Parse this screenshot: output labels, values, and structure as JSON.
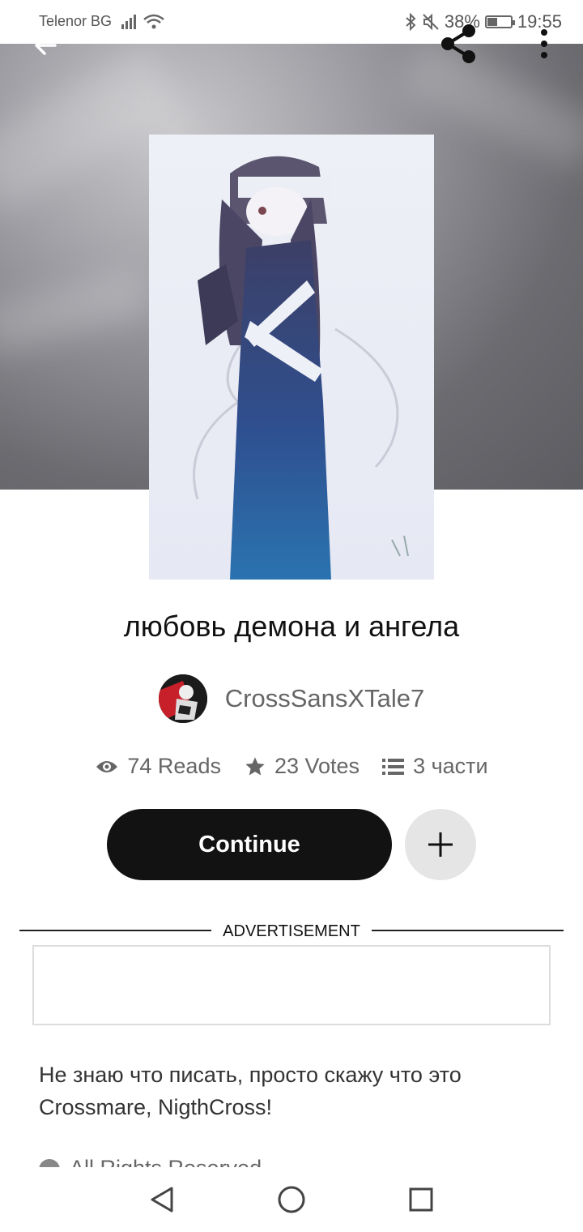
{
  "status_bar": {
    "carrier": "Telenor BG",
    "battery": "38%",
    "time": "19:55"
  },
  "header": {
    "back_icon": "arrow-left-icon",
    "share_icon": "share-icon",
    "more_icon": "more-vertical-icon"
  },
  "story": {
    "title": "любовь демона и ангела",
    "author": "CrossSansXTale7",
    "reads": "74 Reads",
    "votes": "23 Votes",
    "parts": "3 части",
    "description_line1": "Не знаю что писать, просто скажу что это",
    "description_line2": "Crossmare, NigthCross!",
    "rights": "All Rights Reserved"
  },
  "actions": {
    "continue_label": "Continue",
    "add_icon": "plus-icon"
  },
  "ad": {
    "label": "ADVERTISEMENT"
  },
  "colors": {
    "primary_button": "#121212",
    "secondary_button": "#e5e5e6",
    "text_muted": "#666666"
  }
}
